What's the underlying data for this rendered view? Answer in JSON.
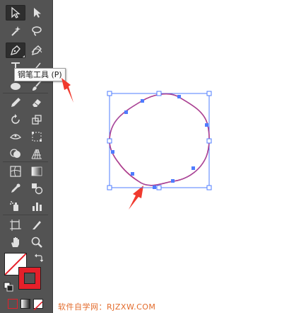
{
  "app": {
    "tooltip": "钢笔工具 (P)"
  },
  "watermark": "软件自学网：RJZXW.COM",
  "colors": {
    "toolbar_bg": "#535353",
    "selected_tool_bg": "#2e2e2e",
    "stroke_color": "#e5202a",
    "path_color": "#c2185b",
    "anchor_color": "#4f7cff",
    "arrow_color": "#f03a2e",
    "watermark_color": "#e36b2b"
  },
  "tools": [
    {
      "id": "selection",
      "icon": "selection-arrow-icon",
      "selected": true
    },
    {
      "id": "direct-selection",
      "icon": "direct-selection-arrow-icon"
    },
    {
      "id": "magic-wand",
      "icon": "magic-wand-icon"
    },
    {
      "id": "lasso",
      "icon": "lasso-icon"
    },
    {
      "id": "pen",
      "icon": "pen-icon",
      "selected": true
    },
    {
      "id": "curvature",
      "icon": "curvature-pen-icon"
    },
    {
      "id": "type",
      "icon": "type-icon"
    },
    {
      "id": "line",
      "icon": "line-segment-icon"
    },
    {
      "id": "ellipse",
      "icon": "ellipse-icon"
    },
    {
      "id": "paintbrush",
      "icon": "paintbrush-icon"
    },
    {
      "id": "pencil",
      "icon": "pencil-icon"
    },
    {
      "id": "eraser",
      "icon": "eraser-icon"
    },
    {
      "id": "rotate",
      "icon": "rotate-icon"
    },
    {
      "id": "scale",
      "icon": "scale-icon"
    },
    {
      "id": "width",
      "icon": "width-icon"
    },
    {
      "id": "free-transform",
      "icon": "free-transform-icon"
    },
    {
      "id": "shape-builder",
      "icon": "shape-builder-icon"
    },
    {
      "id": "perspective",
      "icon": "perspective-grid-icon"
    },
    {
      "id": "mesh",
      "icon": "mesh-icon"
    },
    {
      "id": "gradient",
      "icon": "gradient-icon"
    },
    {
      "id": "eyedropper",
      "icon": "eyedropper-icon"
    },
    {
      "id": "blend",
      "icon": "blend-icon"
    },
    {
      "id": "symbol-sprayer",
      "icon": "symbol-sprayer-icon"
    },
    {
      "id": "column-graph",
      "icon": "column-graph-icon"
    },
    {
      "id": "artboard",
      "icon": "artboard-icon"
    },
    {
      "id": "slice",
      "icon": "slice-icon"
    },
    {
      "id": "hand",
      "icon": "hand-icon"
    },
    {
      "id": "zoom",
      "icon": "zoom-icon"
    }
  ]
}
